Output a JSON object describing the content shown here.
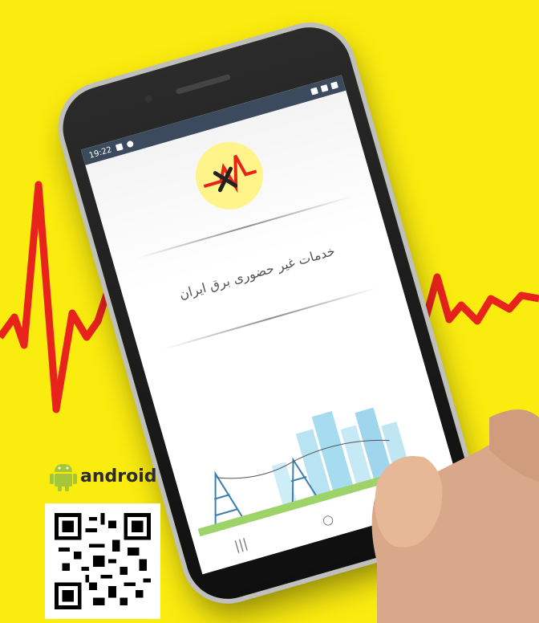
{
  "status_bar": {
    "time": "19:22"
  },
  "app": {
    "title": "خدمات غیر حضوری برق ایران"
  },
  "nav_bar": {
    "recent_icon": "|||",
    "home_icon": "○",
    "back_icon": "‹"
  },
  "badge": {
    "platform_label": "android"
  },
  "colors": {
    "background": "#fbec0f",
    "pulse_line": "#e8231c",
    "android_green": "#a4c639",
    "status_bar": "#3b4a5c"
  }
}
